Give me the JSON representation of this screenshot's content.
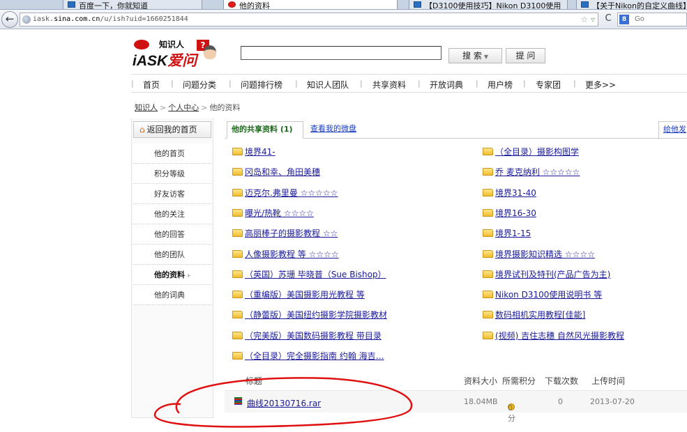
{
  "browser": {
    "tabs": [
      {
        "label": "百度一下，你就知道",
        "active": false
      },
      {
        "label": "他的资料",
        "active": true
      },
      {
        "label": "【D3100使用技巧】Nikon D3100使用",
        "active": false
      },
      {
        "label": "【关于Nikon的自定义曲线】",
        "active": false
      }
    ],
    "url_prefix": "iask.",
    "url_host": "sina.com.cn",
    "url_path": "/u/ish?uid=1660251844",
    "search_placeholder": "Go"
  },
  "header": {
    "logo_top": "知识人",
    "logo_ask": "iASK",
    "logo_ai": "爱问",
    "question_icon": "?",
    "search_input_value": "",
    "search_button": "搜 索",
    "ask_button": "提 问"
  },
  "nav": [
    "首页",
    "问题分类",
    "问题排行榜",
    "知识人团队",
    "共享资料",
    "开放词典",
    "用户榜",
    "专家团",
    "更多>>"
  ],
  "breadcrumb": [
    "知识人",
    "个人中心",
    "他的资料"
  ],
  "sidebar": {
    "home": "返回我的首页",
    "items": [
      "他的首页",
      "积分等级",
      "好友访客",
      "他的关注",
      "他的回答",
      "他的团队",
      "他的资料",
      "他的词典"
    ],
    "active_index": 6
  },
  "content": {
    "tab_active": "他的共享资料 (1)",
    "tab_other": "查看我的微盘",
    "tab_give": "给他发",
    "folders_left": [
      "境界41-",
      "冈岛和幸、角田美穗",
      "迈克尔.弗里曼 ☆☆☆☆☆",
      "曝光/热靴 ☆☆☆☆",
      "高丽棒子的摄影教程 ☆☆",
      "人像摄影教程 等 ☆☆☆☆",
      "（英国）苏珊 毕晓普（Sue Bishop）",
      "（重编版）美国摄影用光教程 等",
      "（静蕾版）美国纽约摄影学院摄影教材",
      "（完美版）美国数码摄影教程 带目录",
      "（全目录）完全摄影指南 约翰 海吉…"
    ],
    "folders_right": [
      "（全目录）摄影构图学",
      "乔 麦克纳利 ☆☆☆☆☆",
      "境界31-40",
      "境界16-30",
      "境界1-15",
      "境界摄影知识精选 ☆☆☆☆",
      "境界试刊及特刊(产品广告为主)",
      "Nikon D3100使用说明书 等",
      "数码相机实用教程[佳能]",
      "(视频) 吉住志穗 自然风光摄影教程"
    ],
    "file_table": {
      "headers": [
        "标题",
        "资料大小",
        "所需积分",
        "下载次数",
        "上传时间"
      ],
      "rows": [
        {
          "name": "曲线20130716.rar",
          "size": "18.04MB",
          "points": "0分",
          "downloads": "0",
          "date": "2013-07-20"
        }
      ]
    }
  },
  "colors": {
    "annotation": "#e01010",
    "link": "#1a1a9a",
    "brand": "#d01111"
  }
}
